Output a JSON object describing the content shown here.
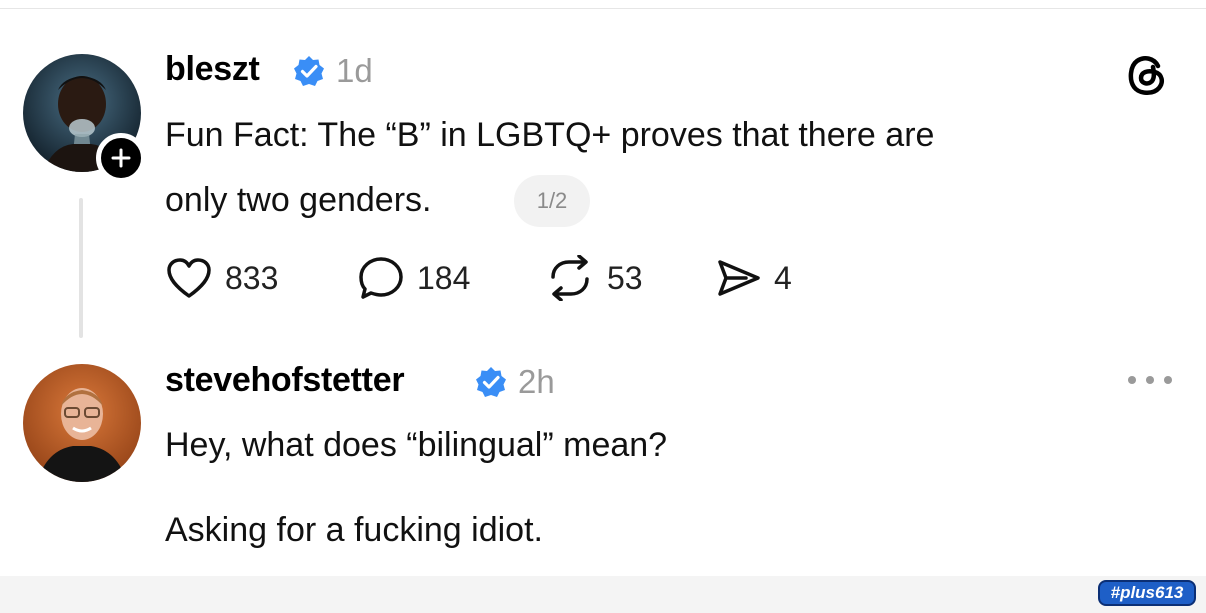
{
  "post": {
    "username": "bleszt",
    "time": "1d",
    "text_line1": "Fun Fact: The “B” in LGBTQ+ proves that there are",
    "text_line2": "only two genders.",
    "thread_counter": "1/2",
    "likes": "833",
    "replies": "184",
    "reposts": "53",
    "shares": "4"
  },
  "reply": {
    "username": "stevehofstetter",
    "time": "2h",
    "text_line1": "Hey, what does “bilingual” mean?",
    "text_line2": "Asking for a fucking idiot."
  },
  "watermark": "#plus613",
  "colors": {
    "verified": "#3a8ef6",
    "muted": "#9a9a9a",
    "text": "#111111"
  },
  "icons": [
    "threads-logo-icon",
    "verified-badge-icon",
    "plus-icon",
    "heart-icon",
    "comment-icon",
    "repost-icon",
    "share-icon",
    "more-icon"
  ]
}
